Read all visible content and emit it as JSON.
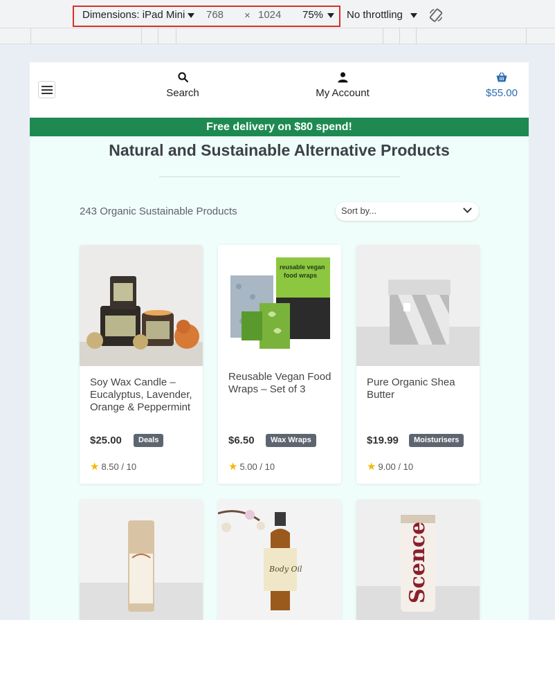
{
  "devtools": {
    "dimensions_label": "Dimensions: iPad Mini",
    "width_value": "768",
    "times_sign": "×",
    "height_value": "1024",
    "zoom": "75%",
    "throttling": "No throttling"
  },
  "header": {
    "search_label": "Search",
    "account_label": "My Account",
    "cart_total": "$55.00"
  },
  "promo": {
    "text": "Free delivery on $80 spend!"
  },
  "page": {
    "title": "Natural and Sustainable Alternative Products",
    "product_count": "243 Organic Sustainable Products",
    "sort_placeholder": "Sort by..."
  },
  "products": [
    {
      "name": "Soy Wax Candle – Eucalyptus, Lavender, Orange & Peppermint",
      "price": "$25.00",
      "category": "Deals",
      "rating": "8.50 / 10"
    },
    {
      "name": "Reusable Vegan Food Wraps – Set of 3",
      "price": "$6.50",
      "category": "Wax Wraps",
      "rating": "5.00 / 10"
    },
    {
      "name": "Pure Organic Shea Butter",
      "price": "$19.99",
      "category": "Moisturisers",
      "rating": "9.00 / 10"
    }
  ],
  "colors": {
    "promo": "#1e8a52",
    "cart": "#2b6cb0",
    "star": "#f5b800",
    "badge": "#5d6670",
    "highlight_box": "#d93025"
  }
}
